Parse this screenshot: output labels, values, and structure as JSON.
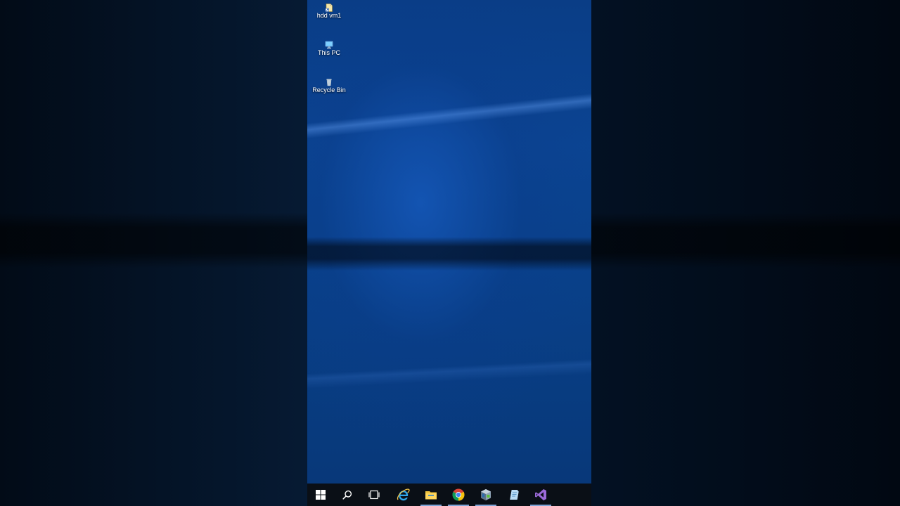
{
  "desktop": {
    "icons": [
      {
        "label": "hdd vm1",
        "icon": "file-shortcut-icon"
      },
      {
        "label": "This PC",
        "icon": "computer-icon"
      },
      {
        "label": "Recycle Bin",
        "icon": "recycle-bin-icon"
      }
    ]
  },
  "taskbar": {
    "buttons": [
      {
        "name": "start",
        "icon": "windows-logo-icon",
        "running": false
      },
      {
        "name": "search",
        "icon": "search-icon",
        "running": false
      },
      {
        "name": "task-view",
        "icon": "task-view-icon",
        "running": false
      },
      {
        "name": "internet-explorer",
        "icon": "internet-explorer-icon",
        "running": false
      },
      {
        "name": "file-explorer",
        "icon": "folder-icon",
        "running": true
      },
      {
        "name": "chrome",
        "icon": "chrome-icon",
        "running": true
      },
      {
        "name": "virtual-machine",
        "icon": "vm-box-icon",
        "running": true
      },
      {
        "name": "notes",
        "icon": "notepad-icon",
        "running": false
      },
      {
        "name": "visual-studio",
        "icon": "visual-studio-icon",
        "running": true
      }
    ]
  },
  "colors": {
    "wallpaper": "#0b4492",
    "taskbar": "#0a0f16",
    "accent": "#7ea4d6"
  }
}
